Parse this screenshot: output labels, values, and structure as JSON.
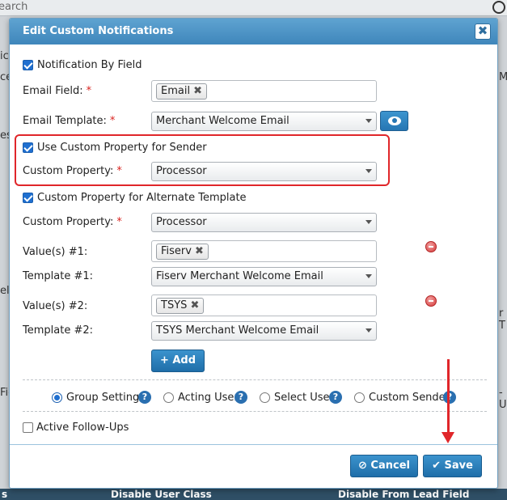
{
  "background": {
    "search_text": "earch",
    "left_fragments": [
      "ic",
      "cer",
      "es",
      "el",
      "Fic"
    ],
    "right_fragments": [
      "Mo",
      "r T",
      "-Us"
    ],
    "bottom_left": "s",
    "bottom_mid": "Disable User Class",
    "bottom_right": "Disable From Lead Field"
  },
  "modal": {
    "title": "Edit Custom Notifications",
    "close_label": "✖"
  },
  "form": {
    "notification_by_field": {
      "label": "Notification By Field",
      "checked": true
    },
    "email_field": {
      "label": "Email Field:",
      "required": "*",
      "tag": "Email",
      "tag_remove": "✖"
    },
    "email_template": {
      "label": "Email Template:",
      "required": "*",
      "value": "Merchant Welcome Email"
    },
    "custom_property_sender": {
      "label": "Use Custom Property for Sender",
      "checked": true
    },
    "custom_property_1": {
      "label": "Custom Property:",
      "required": "*",
      "value": "Processor"
    },
    "alternate_template": {
      "label": "Custom Property for Alternate Template",
      "checked": true
    },
    "custom_property_2": {
      "label": "Custom Property:",
      "required": "*",
      "value": "Processor"
    },
    "value_1": {
      "label": "Value(s) #1:",
      "tag": "Fiserv",
      "tag_remove": "✖"
    },
    "template_1": {
      "label": "Template #1:",
      "value": "Fiserv Merchant Welcome Email"
    },
    "value_2": {
      "label": "Value(s) #2:",
      "tag": "TSYS",
      "tag_remove": "✖"
    },
    "template_2": {
      "label": "Template #2:",
      "value": "TSYS Merchant Welcome Email"
    },
    "add_button": "+ Add"
  },
  "sender_options": [
    {
      "label": "Group Settings",
      "selected": true,
      "help": "?"
    },
    {
      "label": "Acting User",
      "selected": false,
      "help": "?"
    },
    {
      "label": "Select User",
      "selected": false,
      "help": "?"
    },
    {
      "label": "Custom Sender",
      "selected": false,
      "help": "?"
    }
  ],
  "active_followups": {
    "label": "Active Follow-Ups",
    "checked": false
  },
  "footer": {
    "cancel_label": "⊘ Cancel",
    "save_label": "✔ Save"
  },
  "colors": {
    "header": "#3f86bb",
    "button": "#1f6ea9",
    "annotation": "#e0262a"
  }
}
